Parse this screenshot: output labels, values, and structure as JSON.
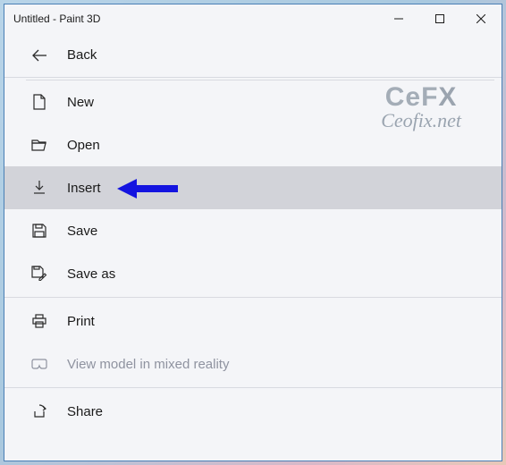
{
  "titlebar": {
    "title": "Untitled - Paint 3D"
  },
  "menu": {
    "back": "Back",
    "new": "New",
    "open": "Open",
    "insert": "Insert",
    "save": "Save",
    "save_as": "Save as",
    "print": "Print",
    "view_mr": "View model in mixed reality",
    "share": "Share"
  },
  "watermark": {
    "top": "CeFX",
    "bottom": "Ceofix.net"
  },
  "highlight": "insert"
}
